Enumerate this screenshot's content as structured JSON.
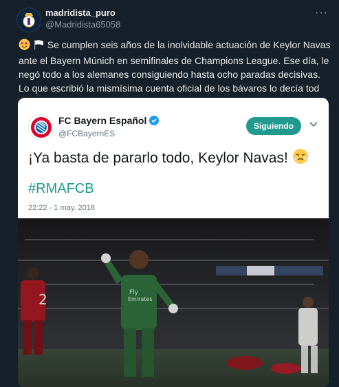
{
  "tweet": {
    "author_name": "madridista_puro",
    "author_handle": "@Madridista65058",
    "more_icon": "more-icon",
    "text": "Se cumplen seis años de la inolvidable actuación de Keylor Navas ante el Bayern Múnich en semifinales de Champions League. Ese día, le negó todo a los alemanes consiguiendo hasta ocho paradas decisivas. Lo que escribió la mismísima cuenta oficial de los bávaros lo decía tod"
  },
  "embedded": {
    "name": "FC Bayern Español",
    "handle": "@FCBayernES",
    "follow_label": "Siguiendo",
    "quote": "¡Ya basta de pararlo todo, Keylor Navas!",
    "hashtag": "#RMAFCB",
    "date": "22:22 - 1 may. 2018",
    "photo_banner_left": "",
    "photo_banner_right": ""
  },
  "colors": {
    "background": "#15202b",
    "follow_button": "#22998d",
    "hashtag": "#1f9a8e",
    "verified": "#1d9bf0"
  }
}
